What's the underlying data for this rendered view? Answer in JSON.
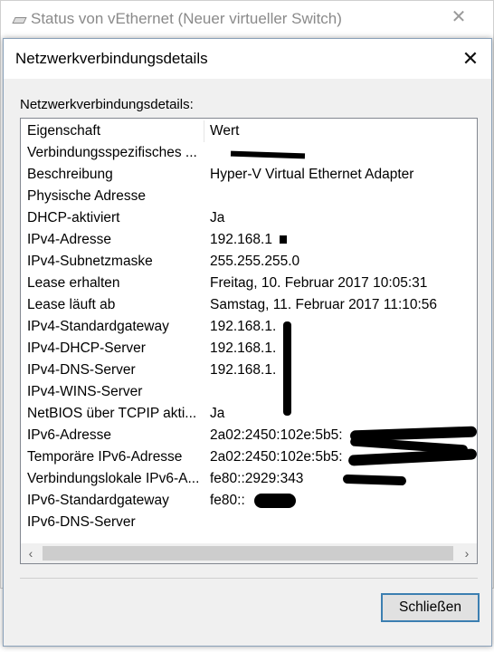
{
  "background_window": {
    "title": "Status von vEthernet (Neuer virtueller Switch)",
    "close_glyph": "✕"
  },
  "dialog": {
    "title": "Netzwerkverbindungsdetails",
    "close_glyph": "✕",
    "section_label": "Netzwerkverbindungsdetails:",
    "columns": {
      "property": "Eigenschaft",
      "value": "Wert"
    },
    "rows": [
      {
        "property": "Verbindungsspezifisches ...",
        "value": ""
      },
      {
        "property": "Beschreibung",
        "value": "Hyper-V Virtual Ethernet Adapter"
      },
      {
        "property": "Physische Adresse",
        "value": ""
      },
      {
        "property": "DHCP-aktiviert",
        "value": "Ja"
      },
      {
        "property": "IPv4-Adresse",
        "value": "192.168.1"
      },
      {
        "property": "IPv4-Subnetzmaske",
        "value": "255.255.255.0"
      },
      {
        "property": "Lease erhalten",
        "value": "Freitag, 10. Februar 2017 10:05:31"
      },
      {
        "property": "Lease läuft ab",
        "value": "Samstag, 11. Februar 2017 11:10:56"
      },
      {
        "property": "IPv4-Standardgateway",
        "value": "192.168.1."
      },
      {
        "property": "IPv4-DHCP-Server",
        "value": "192.168.1."
      },
      {
        "property": "IPv4-DNS-Server",
        "value": "192.168.1."
      },
      {
        "property": "IPv4-WINS-Server",
        "value": ""
      },
      {
        "property": "NetBIOS über TCPIP akti...",
        "value": "Ja"
      },
      {
        "property": "IPv6-Adresse",
        "value": "2a02:2450:102e:5b5:"
      },
      {
        "property": "Temporäre IPv6-Adresse",
        "value": "2a02:2450:102e:5b5:"
      },
      {
        "property": "Verbindungslokale IPv6-A...",
        "value": "fe80::2929:343"
      },
      {
        "property": "IPv6-Standardgateway",
        "value": "fe80::"
      },
      {
        "property": "IPv6-DNS-Server",
        "value": ""
      }
    ],
    "scrollbar": {
      "left_arrow": "‹",
      "right_arrow": "›"
    },
    "close_button_label": "Schließen"
  },
  "colors": {
    "dialog_background": "#f0f0f0",
    "button_border_accent": "#3c7fb1",
    "redaction": "#000000"
  },
  "icons": [
    "network-connection-icon",
    "close-icon",
    "scroll-left-icon",
    "scroll-right-icon"
  ]
}
